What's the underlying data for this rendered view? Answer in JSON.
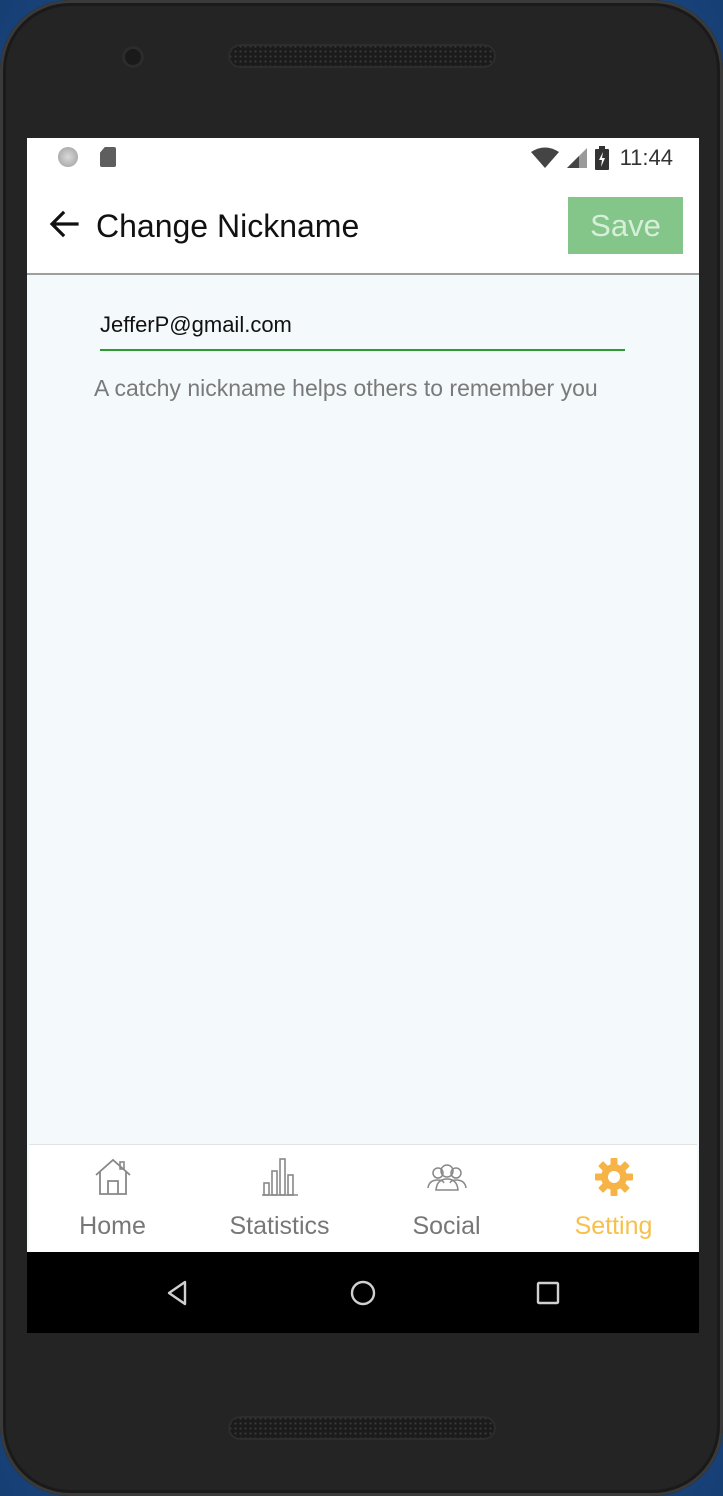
{
  "status_bar": {
    "time": "11:44",
    "icons": [
      "notification-dot-icon",
      "sd-card-icon",
      "wifi-icon",
      "cell-signal-icon",
      "battery-charging-icon"
    ]
  },
  "toolbar": {
    "back_icon": "arrow-left-icon",
    "title": "Change Nickname",
    "save_label": "Save"
  },
  "form": {
    "nickname_value": "JefferP@gmail.com",
    "hint": "A catchy nickname helps others to remember you"
  },
  "bottom_nav": {
    "items": [
      {
        "label": "Home",
        "icon": "home-icon",
        "active": false
      },
      {
        "label": "Statistics",
        "icon": "bar-chart-icon",
        "active": false
      },
      {
        "label": "Social",
        "icon": "people-icon",
        "active": false
      },
      {
        "label": "Setting",
        "icon": "gear-icon",
        "active": true
      }
    ]
  },
  "system_nav": {
    "icons": [
      "back-triangle-icon",
      "home-circle-icon",
      "recents-square-icon"
    ]
  },
  "colors": {
    "save_button_bg": "#84c689",
    "input_underline": "#2e9a32",
    "active_nav": "#f7c04c",
    "screen_bg": "#f4f9fc"
  }
}
